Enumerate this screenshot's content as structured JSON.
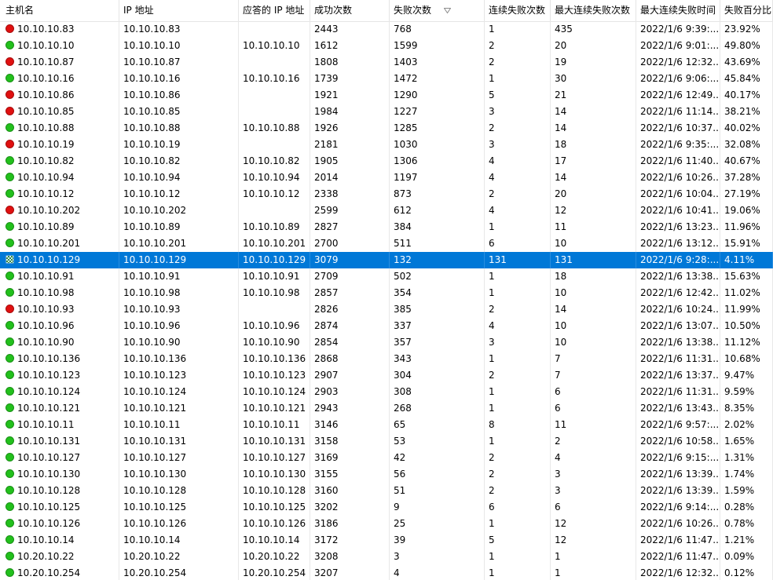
{
  "columns": {
    "host": "主机名",
    "ip": "IP 地址",
    "reply_ip": "应答的 IP 地址",
    "success": "成功次数",
    "fail": "失败次数",
    "consec_fail": "连续失败次数",
    "max_consec_fail": "最大连续失败次数",
    "max_consec_fail_time": "最大连续失败时间",
    "fail_pct": "失败百分比"
  },
  "sort_column": "fail",
  "status_colors": {
    "green": "#22c01c",
    "red": "#e01010"
  },
  "rows": [
    {
      "status": "red",
      "host": "10.10.10.83",
      "ip": "10.10.10.83",
      "reply_ip": "",
      "success": "2443",
      "fail": "768",
      "consec_fail": "1",
      "max_consec_fail": "435",
      "time": "2022/1/6 9:39:...",
      "pct": "23.92%"
    },
    {
      "status": "green",
      "host": "10.10.10.10",
      "ip": "10.10.10.10",
      "reply_ip": "10.10.10.10",
      "success": "1612",
      "fail": "1599",
      "consec_fail": "2",
      "max_consec_fail": "20",
      "time": "2022/1/6 9:01:...",
      "pct": "49.80%"
    },
    {
      "status": "red",
      "host": "10.10.10.87",
      "ip": "10.10.10.87",
      "reply_ip": "",
      "success": "1808",
      "fail": "1403",
      "consec_fail": "2",
      "max_consec_fail": "19",
      "time": "2022/1/6 12:32...",
      "pct": "43.69%"
    },
    {
      "status": "green",
      "host": "10.10.10.16",
      "ip": "10.10.10.16",
      "reply_ip": "10.10.10.16",
      "success": "1739",
      "fail": "1472",
      "consec_fail": "1",
      "max_consec_fail": "30",
      "time": "2022/1/6 9:06:...",
      "pct": "45.84%"
    },
    {
      "status": "red",
      "host": "10.10.10.86",
      "ip": "10.10.10.86",
      "reply_ip": "",
      "success": "1921",
      "fail": "1290",
      "consec_fail": "5",
      "max_consec_fail": "21",
      "time": "2022/1/6 12:49...",
      "pct": "40.17%"
    },
    {
      "status": "red",
      "host": "10.10.10.85",
      "ip": "10.10.10.85",
      "reply_ip": "",
      "success": "1984",
      "fail": "1227",
      "consec_fail": "3",
      "max_consec_fail": "14",
      "time": "2022/1/6 11:14...",
      "pct": "38.21%"
    },
    {
      "status": "green",
      "host": "10.10.10.88",
      "ip": "10.10.10.88",
      "reply_ip": "10.10.10.88",
      "success": "1926",
      "fail": "1285",
      "consec_fail": "2",
      "max_consec_fail": "14",
      "time": "2022/1/6 10:37...",
      "pct": "40.02%"
    },
    {
      "status": "red",
      "host": "10.10.10.19",
      "ip": "10.10.10.19",
      "reply_ip": "",
      "success": "2181",
      "fail": "1030",
      "consec_fail": "3",
      "max_consec_fail": "18",
      "time": "2022/1/6 9:35:...",
      "pct": "32.08%"
    },
    {
      "status": "green",
      "host": "10.10.10.82",
      "ip": "10.10.10.82",
      "reply_ip": "10.10.10.82",
      "success": "1905",
      "fail": "1306",
      "consec_fail": "4",
      "max_consec_fail": "17",
      "time": "2022/1/6 11:40...",
      "pct": "40.67%"
    },
    {
      "status": "green",
      "host": "10.10.10.94",
      "ip": "10.10.10.94",
      "reply_ip": "10.10.10.94",
      "success": "2014",
      "fail": "1197",
      "consec_fail": "4",
      "max_consec_fail": "14",
      "time": "2022/1/6 10:26...",
      "pct": "37.28%"
    },
    {
      "status": "green",
      "host": "10.10.10.12",
      "ip": "10.10.10.12",
      "reply_ip": "10.10.10.12",
      "success": "2338",
      "fail": "873",
      "consec_fail": "2",
      "max_consec_fail": "20",
      "time": "2022/1/6 10:04...",
      "pct": "27.19%"
    },
    {
      "status": "red",
      "host": "10.10.10.202",
      "ip": "10.10.10.202",
      "reply_ip": "",
      "success": "2599",
      "fail": "612",
      "consec_fail": "4",
      "max_consec_fail": "12",
      "time": "2022/1/6 10:41...",
      "pct": "19.06%"
    },
    {
      "status": "green",
      "host": "10.10.10.89",
      "ip": "10.10.10.89",
      "reply_ip": "10.10.10.89",
      "success": "2827",
      "fail": "384",
      "consec_fail": "1",
      "max_consec_fail": "11",
      "time": "2022/1/6 13:23...",
      "pct": "11.96%"
    },
    {
      "status": "green",
      "host": "10.10.10.201",
      "ip": "10.10.10.201",
      "reply_ip": "10.10.10.201",
      "success": "2700",
      "fail": "511",
      "consec_fail": "6",
      "max_consec_fail": "10",
      "time": "2022/1/6 13:12...",
      "pct": "15.91%"
    },
    {
      "status": "checker",
      "selected": true,
      "host": "10.10.10.129",
      "ip": "10.10.10.129",
      "reply_ip": "10.10.10.129",
      "success": "3079",
      "fail": "132",
      "consec_fail": "131",
      "max_consec_fail": "131",
      "time": "2022/1/6 9:28:...",
      "pct": "4.11%"
    },
    {
      "status": "green",
      "host": "10.10.10.91",
      "ip": "10.10.10.91",
      "reply_ip": "10.10.10.91",
      "success": "2709",
      "fail": "502",
      "consec_fail": "1",
      "max_consec_fail": "18",
      "time": "2022/1/6 13:38...",
      "pct": "15.63%"
    },
    {
      "status": "green",
      "host": "10.10.10.98",
      "ip": "10.10.10.98",
      "reply_ip": "10.10.10.98",
      "success": "2857",
      "fail": "354",
      "consec_fail": "1",
      "max_consec_fail": "10",
      "time": "2022/1/6 12:42...",
      "pct": "11.02%"
    },
    {
      "status": "red",
      "host": "10.10.10.93",
      "ip": "10.10.10.93",
      "reply_ip": "",
      "success": "2826",
      "fail": "385",
      "consec_fail": "2",
      "max_consec_fail": "14",
      "time": "2022/1/6 10:24...",
      "pct": "11.99%"
    },
    {
      "status": "green",
      "host": "10.10.10.96",
      "ip": "10.10.10.96",
      "reply_ip": "10.10.10.96",
      "success": "2874",
      "fail": "337",
      "consec_fail": "4",
      "max_consec_fail": "10",
      "time": "2022/1/6 13:07...",
      "pct": "10.50%"
    },
    {
      "status": "green",
      "host": "10.10.10.90",
      "ip": "10.10.10.90",
      "reply_ip": "10.10.10.90",
      "success": "2854",
      "fail": "357",
      "consec_fail": "3",
      "max_consec_fail": "10",
      "time": "2022/1/6 13:38...",
      "pct": "11.12%"
    },
    {
      "status": "green",
      "host": "10.10.10.136",
      "ip": "10.10.10.136",
      "reply_ip": "10.10.10.136",
      "success": "2868",
      "fail": "343",
      "consec_fail": "1",
      "max_consec_fail": "7",
      "time": "2022/1/6 11:31...",
      "pct": "10.68%"
    },
    {
      "status": "green",
      "host": "10.10.10.123",
      "ip": "10.10.10.123",
      "reply_ip": "10.10.10.123",
      "success": "2907",
      "fail": "304",
      "consec_fail": "2",
      "max_consec_fail": "7",
      "time": "2022/1/6 13:37...",
      "pct": "9.47%"
    },
    {
      "status": "green",
      "host": "10.10.10.124",
      "ip": "10.10.10.124",
      "reply_ip": "10.10.10.124",
      "success": "2903",
      "fail": "308",
      "consec_fail": "1",
      "max_consec_fail": "6",
      "time": "2022/1/6 11:31...",
      "pct": "9.59%"
    },
    {
      "status": "green",
      "host": "10.10.10.121",
      "ip": "10.10.10.121",
      "reply_ip": "10.10.10.121",
      "success": "2943",
      "fail": "268",
      "consec_fail": "1",
      "max_consec_fail": "6",
      "time": "2022/1/6 13:43...",
      "pct": "8.35%"
    },
    {
      "status": "green",
      "host": "10.10.10.11",
      "ip": "10.10.10.11",
      "reply_ip": "10.10.10.11",
      "success": "3146",
      "fail": "65",
      "consec_fail": "8",
      "max_consec_fail": "11",
      "time": "2022/1/6 9:57:...",
      "pct": "2.02%"
    },
    {
      "status": "green",
      "host": "10.10.10.131",
      "ip": "10.10.10.131",
      "reply_ip": "10.10.10.131",
      "success": "3158",
      "fail": "53",
      "consec_fail": "1",
      "max_consec_fail": "2",
      "time": "2022/1/6 10:58...",
      "pct": "1.65%"
    },
    {
      "status": "green",
      "host": "10.10.10.127",
      "ip": "10.10.10.127",
      "reply_ip": "10.10.10.127",
      "success": "3169",
      "fail": "42",
      "consec_fail": "2",
      "max_consec_fail": "4",
      "time": "2022/1/6 9:15:...",
      "pct": "1.31%"
    },
    {
      "status": "green",
      "host": "10.10.10.130",
      "ip": "10.10.10.130",
      "reply_ip": "10.10.10.130",
      "success": "3155",
      "fail": "56",
      "consec_fail": "2",
      "max_consec_fail": "3",
      "time": "2022/1/6 13:39...",
      "pct": "1.74%"
    },
    {
      "status": "green",
      "host": "10.10.10.128",
      "ip": "10.10.10.128",
      "reply_ip": "10.10.10.128",
      "success": "3160",
      "fail": "51",
      "consec_fail": "2",
      "max_consec_fail": "3",
      "time": "2022/1/6 13:39...",
      "pct": "1.59%"
    },
    {
      "status": "green",
      "host": "10.10.10.125",
      "ip": "10.10.10.125",
      "reply_ip": "10.10.10.125",
      "success": "3202",
      "fail": "9",
      "consec_fail": "6",
      "max_consec_fail": "6",
      "time": "2022/1/6 9:14:...",
      "pct": "0.28%"
    },
    {
      "status": "green",
      "host": "10.10.10.126",
      "ip": "10.10.10.126",
      "reply_ip": "10.10.10.126",
      "success": "3186",
      "fail": "25",
      "consec_fail": "1",
      "max_consec_fail": "12",
      "time": "2022/1/6 10:26...",
      "pct": "0.78%"
    },
    {
      "status": "green",
      "host": "10.10.10.14",
      "ip": "10.10.10.14",
      "reply_ip": "10.10.10.14",
      "success": "3172",
      "fail": "39",
      "consec_fail": "5",
      "max_consec_fail": "12",
      "time": "2022/1/6 11:47...",
      "pct": "1.21%"
    },
    {
      "status": "green",
      "host": "10.20.10.22",
      "ip": "10.20.10.22",
      "reply_ip": "10.20.10.22",
      "success": "3208",
      "fail": "3",
      "consec_fail": "1",
      "max_consec_fail": "1",
      "time": "2022/1/6 11:47...",
      "pct": "0.09%"
    },
    {
      "status": "green",
      "host": "10.20.10.254",
      "ip": "10.20.10.254",
      "reply_ip": "10.20.10.254",
      "success": "3207",
      "fail": "4",
      "consec_fail": "1",
      "max_consec_fail": "1",
      "time": "2022/1/6 12:32...",
      "pct": "0.12%"
    }
  ]
}
